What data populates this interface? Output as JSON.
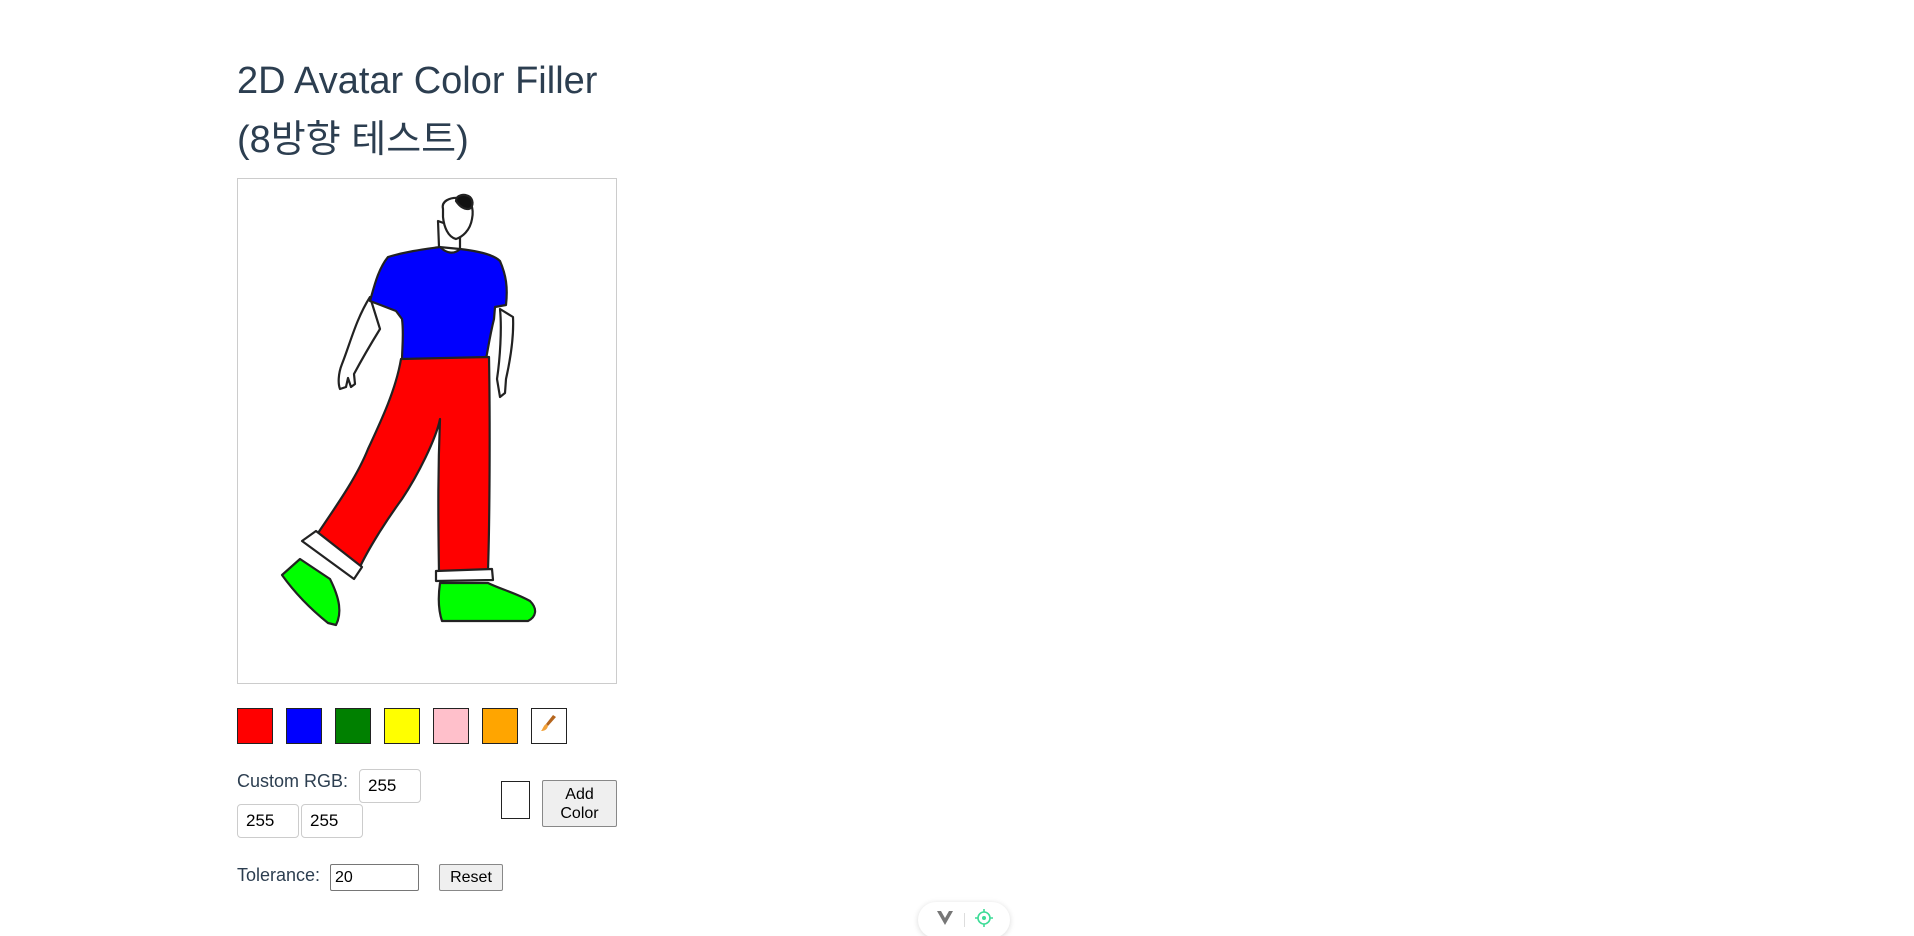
{
  "title_line1": "2D Avatar Color Filler",
  "title_line2": "(8방향 테스트)",
  "palette": [
    {
      "name": "red",
      "color": "#ff0000"
    },
    {
      "name": "blue",
      "color": "#0000ff"
    },
    {
      "name": "green",
      "color": "#008000"
    },
    {
      "name": "yellow",
      "color": "#ffff00"
    },
    {
      "name": "pink",
      "color": "#ffc0cb"
    },
    {
      "name": "orange",
      "color": "#ffa500"
    },
    {
      "name": "eraser",
      "icon": "brush-icon"
    }
  ],
  "custom_rgb": {
    "label": "Custom RGB:",
    "r": "255",
    "g": "255",
    "b": "255",
    "preview_color": "#ffffff",
    "add_label_1": "Add",
    "add_label_2": "Color"
  },
  "tolerance": {
    "label": "Tolerance:",
    "value": "20",
    "reset_label": "Reset"
  },
  "avatar_colors": {
    "shirt": "#0000ff",
    "pants": "#ff0000",
    "shoes": "#00ff00"
  }
}
